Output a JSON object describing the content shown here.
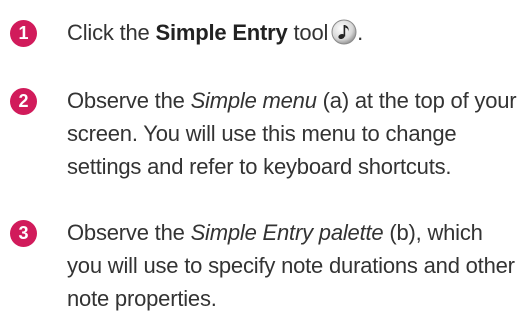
{
  "steps": [
    {
      "number": "1",
      "pre": "Click the ",
      "bold": "Simple Entry",
      "mid": " tool",
      "post": ".",
      "icon": "simple-entry-note-icon"
    },
    {
      "number": "2",
      "pre": "Observe the ",
      "italic": "Simple menu",
      "post": " (a) at the top of your screen. You will use this menu to change settings and refer to keyboard shortcuts."
    },
    {
      "number": "3",
      "pre": "Observe the ",
      "italic": "Simple Entry palette",
      "post": " (b), which you will use to specify note durations and other note properties."
    }
  ],
  "colors": {
    "badge": "#d11b5b",
    "text": "#333333"
  }
}
